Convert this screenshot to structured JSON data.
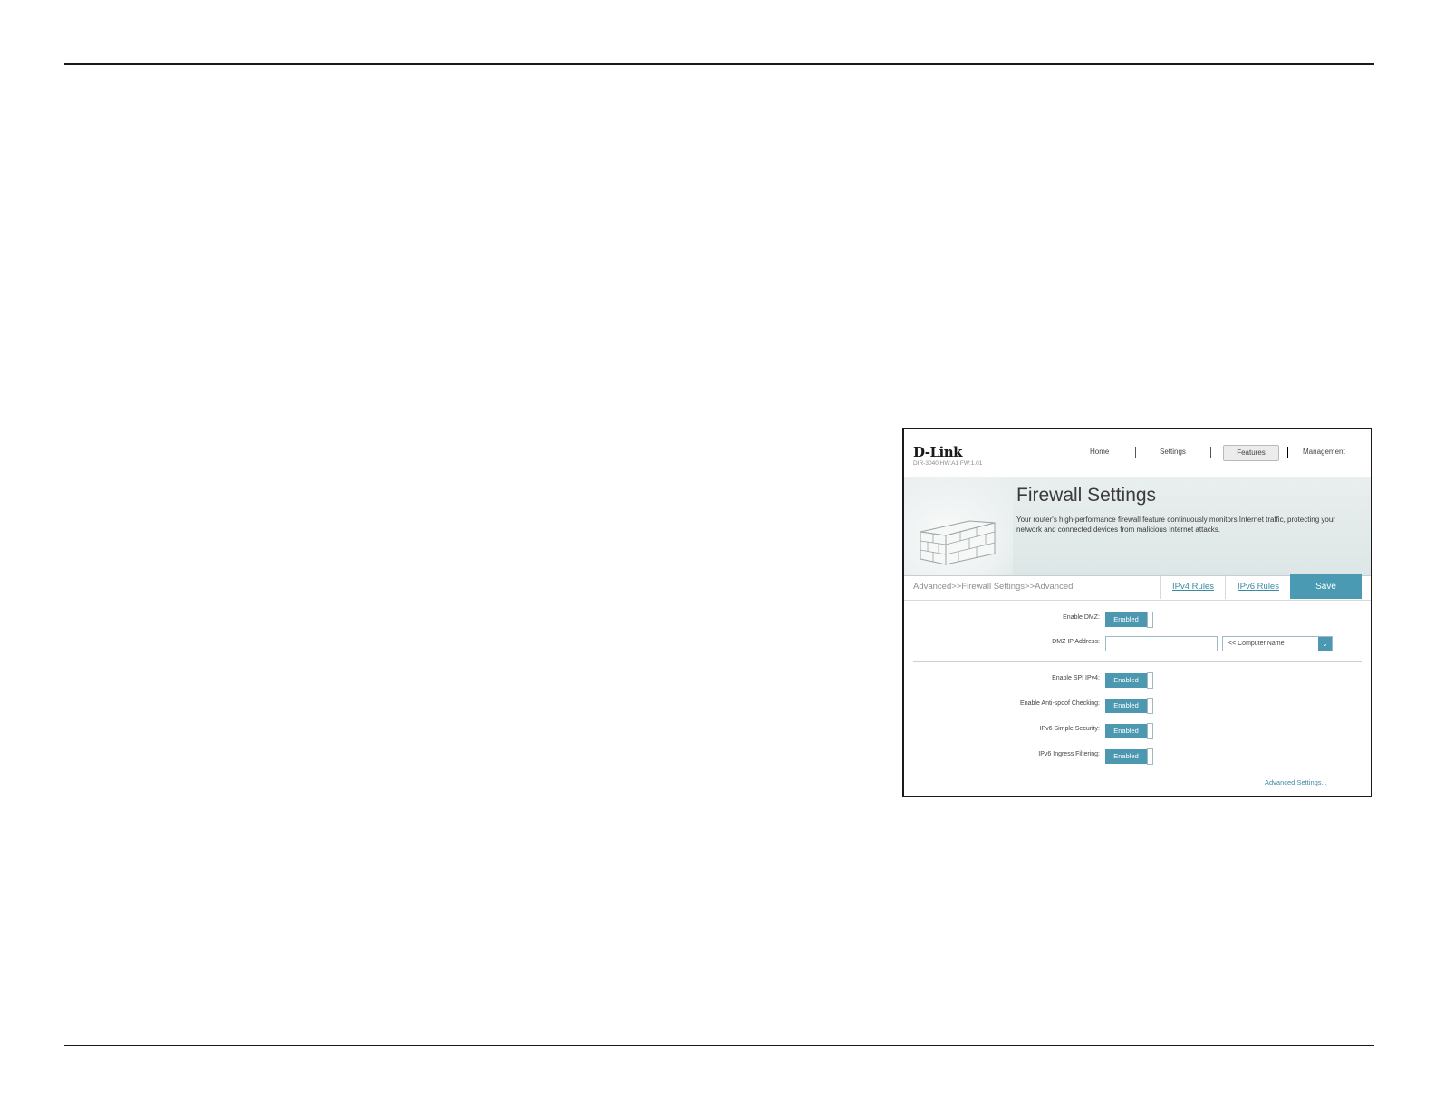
{
  "header": {
    "logo": "D-Link",
    "model": "DIR-3040 HW:A1 FW:1.01",
    "nav": [
      "Home",
      "Settings",
      "Features",
      "Management"
    ],
    "active_nav": "Features"
  },
  "hero": {
    "title": "Firewall Settings",
    "description": "Your router's high-performance firewall feature continuously monitors Internet traffic, protecting your network and connected devices from malicious Internet attacks."
  },
  "subbar": {
    "breadcrumb": "Advanced>>Firewall Settings>>Advanced",
    "tabs": [
      "IPv4 Rules",
      "IPv6 Rules"
    ],
    "save_label": "Save"
  },
  "dmz": {
    "enable_label": "Enable DMZ:",
    "enable_value": "Enabled",
    "ip_label": "DMZ IP Address:",
    "ip_value": "",
    "computer_select": "<< Computer Name"
  },
  "security": [
    {
      "label": "Enable SPI IPv4:",
      "value": "Enabled"
    },
    {
      "label": "Enable Anti-spoof Checking:",
      "value": "Enabled"
    },
    {
      "label": "IPv6 Simple Security:",
      "value": "Enabled"
    },
    {
      "label": "IPv6 Ingress Filtering:",
      "value": "Enabled"
    }
  ],
  "advanced_link": "Advanced Settings...",
  "colors": {
    "accent": "#4b98b0",
    "link": "#3b8aa2"
  }
}
